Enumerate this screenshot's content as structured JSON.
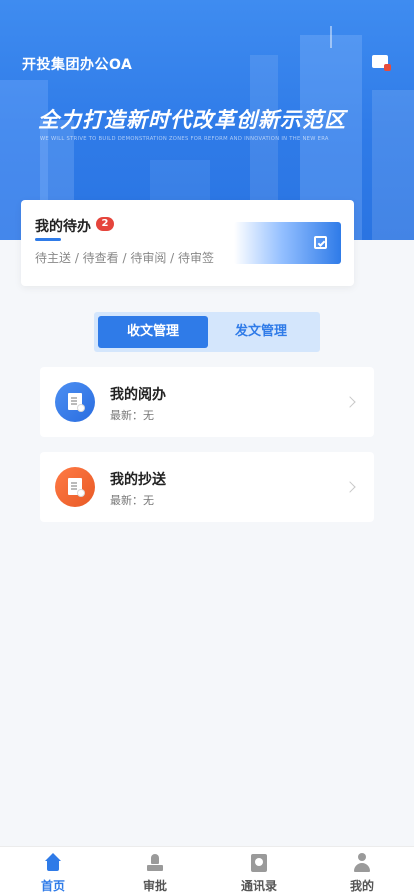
{
  "header": {
    "app_title": "开投集团办公OA",
    "slogan": "全力打造新时代改革创新示范区",
    "slogan_en": "WE WILL STRIVE TO BUILD DEMONSTRATION ZONES FOR REFORM AND INNOVATION IN THE NEW ERA",
    "message_icon": "message-icon"
  },
  "todo": {
    "title": "我的待办",
    "badge": "2",
    "status": "待主送 / 待查看 / 待审阅 / 待审签",
    "action_icon": "calendar-check-icon"
  },
  "tabs": {
    "active": "收文管理",
    "inactive": "发文管理"
  },
  "list": {
    "items": [
      {
        "title": "我的阅办",
        "subtitle": "最新：无",
        "icon": "document-icon",
        "color": "#2f7be8"
      },
      {
        "title": "我的抄送",
        "subtitle": "最新：无",
        "icon": "document-icon",
        "color": "#f06a35"
      }
    ]
  },
  "nav": {
    "items": [
      {
        "label": "首页",
        "icon": "home-icon",
        "active": true
      },
      {
        "label": "审批",
        "icon": "stamp-icon",
        "active": false
      },
      {
        "label": "通讯录",
        "icon": "contacts-icon",
        "active": false
      },
      {
        "label": "我的",
        "icon": "user-icon",
        "active": false
      }
    ]
  },
  "colors": {
    "primary": "#2f7be8",
    "badge": "#e5453c",
    "background": "#f5f7fa"
  }
}
